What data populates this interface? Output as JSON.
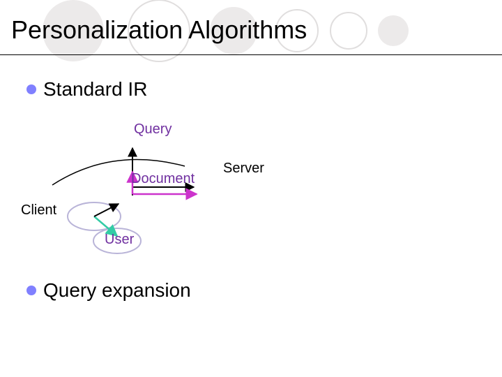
{
  "slide": {
    "title": "Personalization Algorithms",
    "bullets": [
      {
        "label": "Standard IR"
      },
      {
        "label": "Query expansion"
      }
    ]
  },
  "diagram": {
    "labels": {
      "query": "Query",
      "document": "Document",
      "server": "Server",
      "client": "Client",
      "user": "User"
    }
  },
  "colors": {
    "bullet": "#8080ff",
    "accent_purple": "#7030a0",
    "accent_magenta": "#cc33cc",
    "accent_teal": "#33cca6",
    "circle_fill": "#eceaea"
  }
}
